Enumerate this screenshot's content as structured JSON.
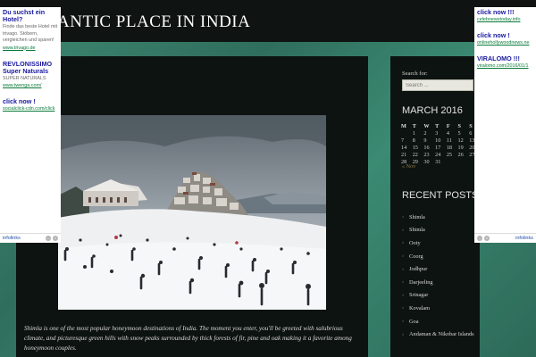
{
  "header": {
    "title": "ANTIC PLACE IN INDIA"
  },
  "post": {
    "excerpt": "Shimla is one of the most popular honeymoon destinations of India. The moment you enter, you'll be greeted with salubrious climate, and picturesque green hills with snow peaks surrounded by thick forests of fir, pine and oak making it a favorite among honeymoon couples."
  },
  "sidebar": {
    "search_label": "Search for:",
    "search_placeholder": "Search ...",
    "calendar": {
      "title": "MARCH 2016",
      "weekdays": [
        "M",
        "T",
        "W",
        "T",
        "F",
        "S",
        "S"
      ],
      "weeks": [
        [
          "",
          "1",
          "2",
          "3",
          "4",
          "5",
          "6"
        ],
        [
          "7",
          "8",
          "9",
          "10",
          "11",
          "12",
          "13"
        ],
        [
          "14",
          "15",
          "16",
          "17",
          "18",
          "19",
          "20"
        ],
        [
          "21",
          "22",
          "23",
          "24",
          "25",
          "26",
          "27"
        ],
        [
          "28",
          "29",
          "30",
          "31",
          "",
          "",
          ""
        ]
      ],
      "prev_link": "« Nov"
    },
    "recent_title": "RECENT POSTS",
    "recent_posts": [
      "Shimla",
      "Shimla",
      "Ooty",
      "Coorg",
      "Jodhpur",
      "Darjeeling",
      "Srinagar",
      "Kovalam",
      "Goa",
      "Andaman & Nikobar Islands"
    ]
  },
  "ad_left": {
    "blocks": [
      {
        "title": "Du suchst ein Hotel?",
        "desc": "Finde das beste Hotel mit trivago. Stöbern, vergleichen und sparen!",
        "url": "www.trivago.de"
      },
      {
        "title": "REVLONISSIMO Super Naturals",
        "desc": "SUPER NATURALS",
        "url": "www.twenga.com/"
      },
      {
        "title": "click now !",
        "desc": "",
        "url": "socialclick-cdn.com/click"
      }
    ],
    "brand": "infolinks"
  },
  "ad_right": {
    "blocks": [
      {
        "title": "click now !!!",
        "url": "celebnewstoday.info"
      },
      {
        "title": "click now !",
        "url": "onlinehollywoodnews.ne"
      },
      {
        "title": "VIRALOMO !!!",
        "url": "viralomo.com/2016/01/1"
      }
    ],
    "brand": "infolinks"
  },
  "colors": {
    "background": "#3f8a73",
    "panel": "#0d1310",
    "ad_title": "#1a1aa0",
    "ad_url": "#0a7a3a"
  }
}
